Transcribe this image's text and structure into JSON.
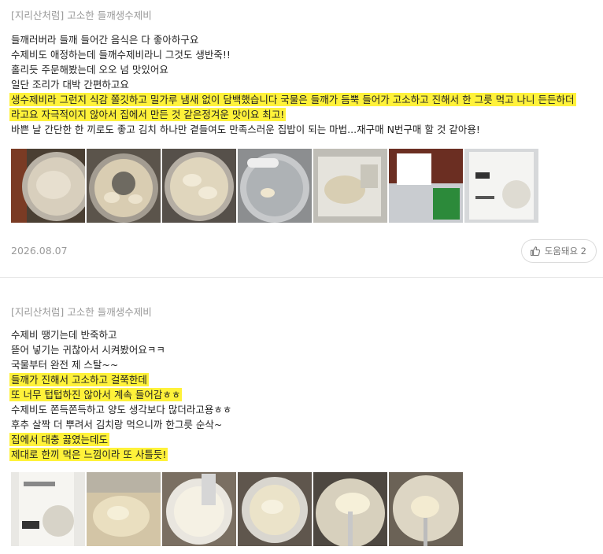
{
  "reviews": [
    {
      "product": "[지리산처럼] 고소한 들깨생수제비",
      "lines": [
        {
          "text": "들깨러버라 들깨 들어간 음식은 다 좋아하구요",
          "highlight": false
        },
        {
          "text": "수제비도 애정하는데 들깨수제비라니 그것도 생반죽!!",
          "highlight": false
        },
        {
          "text": "홀리듯 주문해봤는데 오오 넘 맛있어요",
          "highlight": false
        },
        {
          "text": "일단 조리가 대박 간편하고요",
          "highlight": false
        },
        {
          "text": "생수제비라 그런지 식감 쫄깃하고 밀가루 냄새 없이 담백했습니다 국물은 들깨가 듬뿍 들어가 고소하고 진해서 한 그릇 먹고 나니 든든하더",
          "highlight": true
        },
        {
          "text": "라고요 자극적이지 않아서 집에서 만든 것 같은정겨운 맛이요 최고!",
          "highlight": true
        },
        {
          "text": "바쁜 날 간단한 한 끼로도 좋고 김치 하나만 곁들여도 만족스러운 집밥이 되는 마법...재구매 N번구매 할 것 같아용!",
          "highlight": false
        }
      ],
      "date": "2026.08.07",
      "helpful_label": "도움돼요 2"
    },
    {
      "product": "[지리산처럼] 고소한 들깨생수제비",
      "lines": [
        {
          "text": "수제비 땡기는데 반죽하고",
          "highlight": false
        },
        {
          "text": "뜯어 넣기는 귀찮아서 시켜봤어요ㅋㅋ",
          "highlight": false
        },
        {
          "text": "국물부터 완전 제 스탈~~",
          "highlight": false
        },
        {
          "text": "들깨가 진해서 고소하고 걸쭉한데",
          "highlight": true
        },
        {
          "text": "또 너무 텁텁하진 않아서 계속 들어감ㅎㅎ",
          "highlight": true
        },
        {
          "text": "수제비도 쫀득쫀득하고 양도 생각보다 많더라고용ㅎㅎ",
          "highlight": false
        },
        {
          "text": "후추 살짝 더 뿌려서 김치랑 먹으니까 한그릇 순삭~",
          "highlight": false
        },
        {
          "text": "집에서 대충 끓였는데도",
          "highlight": true
        },
        {
          "text": "제대로 한끼 먹은 느낌이라 또 사틀듯!",
          "highlight": true
        }
      ]
    }
  ],
  "colors": {
    "highlight": "#fff23a",
    "muted": "#9a9a9a",
    "text": "#222222",
    "divider": "#e7e7e7"
  }
}
